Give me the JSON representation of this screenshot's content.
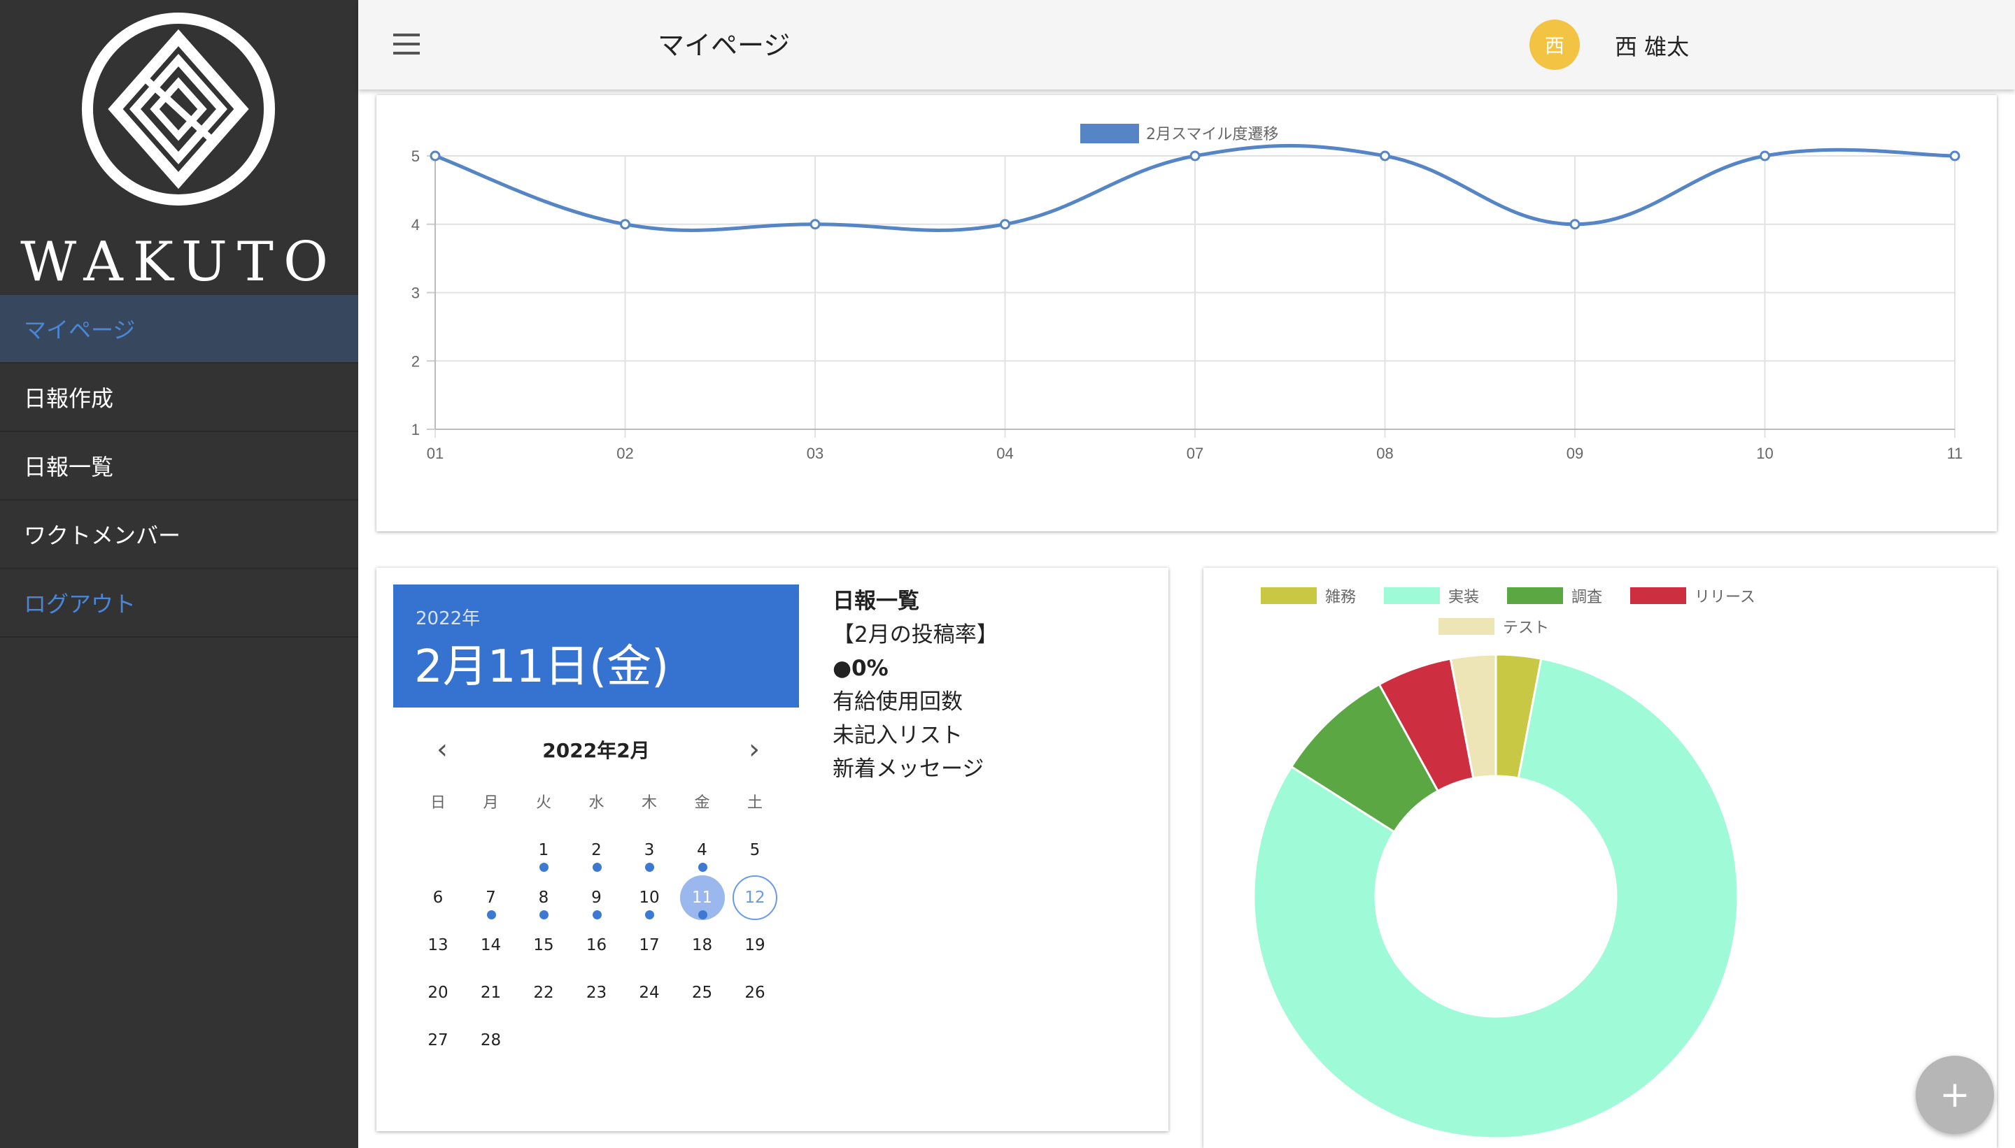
{
  "sidebar": {
    "brand": "WAKUTO",
    "items": [
      {
        "label": "マイページ",
        "active": true
      },
      {
        "label": "日報作成"
      },
      {
        "label": "日報一覧"
      },
      {
        "label": "ワクトメンバー"
      },
      {
        "label": "ログアウト"
      }
    ]
  },
  "header": {
    "title": "マイページ",
    "avatar_initial": "西",
    "user_name": "西 雄太",
    "avatar_color": "#f3c443"
  },
  "chart_data": [
    {
      "type": "line",
      "legend": [
        "2月スマイル度遷移"
      ],
      "legend_position": "top",
      "x": [
        "01",
        "02",
        "03",
        "04",
        "07",
        "08",
        "09",
        "10",
        "11"
      ],
      "series": [
        {
          "name": "2月スマイル度遷移",
          "values": [
            5,
            4,
            4,
            4,
            5,
            5,
            4,
            5,
            5
          ],
          "color": "#5585c5"
        }
      ],
      "ylim": [
        1,
        5
      ],
      "yticks": [
        "5",
        "4",
        "3",
        "2",
        "1"
      ],
      "grid": true
    },
    {
      "type": "pie",
      "legend_position": "top",
      "categories": [
        "雑務",
        "実装",
        "調査",
        "リリース",
        "テスト"
      ],
      "values": [
        3,
        81,
        8,
        5,
        3
      ],
      "colors": [
        "#c9c845",
        "#9efad7",
        "#5aa744",
        "#cd2e40",
        "#eee5b6"
      ]
    }
  ],
  "calendar": {
    "year_label": "2022年",
    "date_label": "2月11日(金)",
    "month_label": "2022年2月",
    "prev_icon": "chevron-left-icon",
    "next_icon": "chevron-right-icon",
    "weekdays": [
      "日",
      "月",
      "火",
      "水",
      "木",
      "金",
      "土"
    ],
    "first_weekday_index": 2,
    "days_in_month": 28,
    "selected_day": 11,
    "today_day": 12,
    "marked_days": [
      1,
      2,
      3,
      4,
      7,
      8,
      9,
      10,
      11
    ]
  },
  "report": {
    "title": "日報一覧",
    "rate_label": "【2月の投稿率】",
    "rate_value": "●0%",
    "paid_leave": "有給使用回数",
    "unfilled": "未記入リスト",
    "messages": "新着メッセージ"
  },
  "fab": {
    "label": "+"
  }
}
